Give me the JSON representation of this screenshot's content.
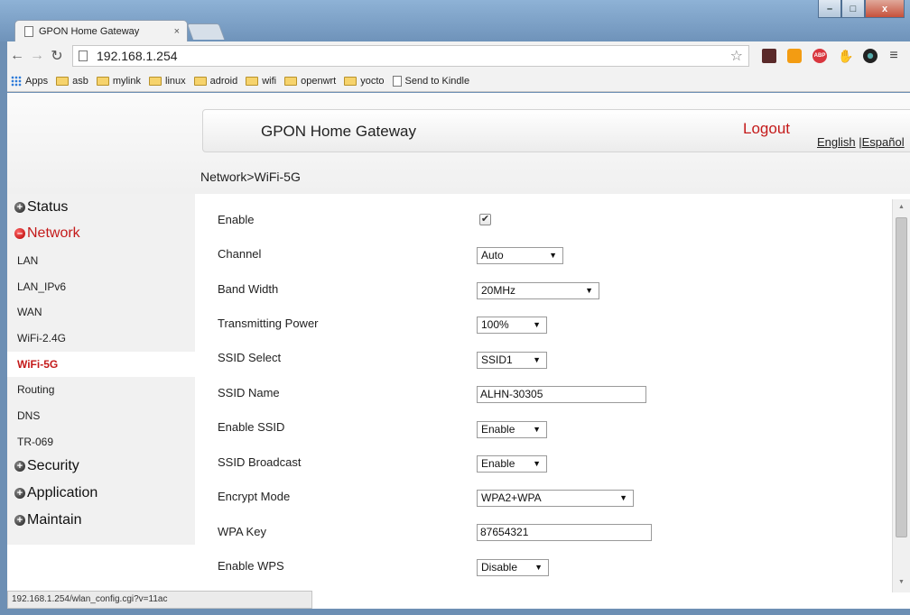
{
  "browser": {
    "tab_title": "GPON Home Gateway",
    "tab_close": "×",
    "url": "192.168.1.254",
    "window_controls": {
      "minimize": "–",
      "maximize": "□",
      "close": "x"
    },
    "bookmarks": [
      "asb",
      "mylink",
      "linux",
      "adroid",
      "wifi",
      "openwrt",
      "yocto"
    ],
    "apps_label": "Apps",
    "send_to_kindle": "Send to Kindle",
    "status_url": "192.168.1.254/wlan_config.cgi?v=11ac",
    "icons": [
      "back-icon",
      "forward-icon",
      "reload-icon",
      "page-icon",
      "star-icon",
      "extension-icon",
      "rss-icon",
      "adblock-icon",
      "menu-icon"
    ]
  },
  "header": {
    "title": "GPON Home Gateway",
    "logout": "Logout",
    "lang_english": "English",
    "lang_sep": " |",
    "lang_spanish": "Español"
  },
  "breadcrumb": "Network>WiFi-5G",
  "sidebar": {
    "categories": {
      "status": "Status",
      "network": "Network",
      "security": "Security",
      "application": "Application",
      "maintain": "Maintain"
    },
    "network_items": [
      "LAN",
      "LAN_IPv6",
      "WAN",
      "WiFi-2.4G",
      "WiFi-5G",
      "Routing",
      "DNS",
      "TR-069"
    ],
    "active": "WiFi-5G"
  },
  "form": {
    "enable": {
      "label": "Enable",
      "checked": true,
      "check_mark": "✔"
    },
    "channel": {
      "label": "Channel",
      "value": "Auto"
    },
    "band_width": {
      "label": "Band Width",
      "value": "20MHz"
    },
    "tx_power": {
      "label": "Transmitting Power",
      "value": "100%"
    },
    "ssid_select": {
      "label": "SSID Select",
      "value": "SSID1"
    },
    "ssid_name": {
      "label": "SSID Name",
      "value": "ALHN-30305"
    },
    "enable_ssid": {
      "label": "Enable SSID",
      "value": "Enable"
    },
    "ssid_broadcast": {
      "label": "SSID Broadcast",
      "value": "Enable"
    },
    "encrypt_mode": {
      "label": "Encrypt Mode",
      "value": "WPA2+WPA"
    },
    "wpa_key": {
      "label": "WPA Key",
      "value": "87654321"
    },
    "enable_wps": {
      "label": "Enable WPS",
      "value": "Disable"
    }
  }
}
